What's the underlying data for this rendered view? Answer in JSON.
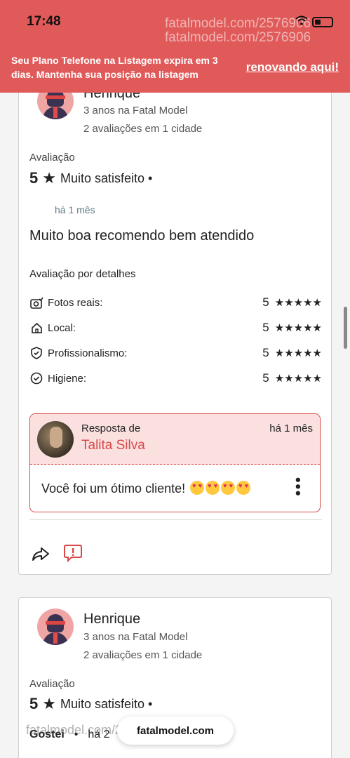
{
  "status": {
    "time": "17:48"
  },
  "watermark": {
    "top_line1": "fatalmodel.com/2576906",
    "top_line2": "fatalmodel.com/2576906",
    "bottom": "fatalmodel.com/2576906"
  },
  "banner": {
    "message": "Seu Plano Telefone na Listagem expira em 3 dias. Mantenha sua posição na listagem",
    "link": "renovando aqui!",
    "color": "#e15a5a"
  },
  "review1": {
    "user_name": "Henrique",
    "user_since": "3 anos na Fatal Model",
    "user_reviews": "2 avaliações em 1 cidade",
    "rating_label": "Avaliação",
    "score": "5",
    "star": "★",
    "verdict": "Muito satisfeito •",
    "time_ago": "há 1 mês",
    "comment": "Muito boa recomendo bem atendido",
    "details_label": "Avaliação por detalhes",
    "details": [
      {
        "label": "Fotos reais:",
        "score": "5",
        "stars": "★★★★★",
        "icon": "camera-check-icon"
      },
      {
        "label": "Local:",
        "score": "5",
        "stars": "★★★★★",
        "icon": "home-icon"
      },
      {
        "label": "Profissionalismo:",
        "score": "5",
        "stars": "★★★★★",
        "icon": "shield-check-icon"
      },
      {
        "label": "Higiene:",
        "score": "5",
        "stars": "★★★★★",
        "icon": "check-circle-icon"
      }
    ],
    "response": {
      "label": "Resposta de",
      "name": "Talita Silva",
      "time": "há 1 mês",
      "text": "Você foi um ótimo cliente!",
      "emoji_count": 4
    }
  },
  "review2": {
    "user_name": "Henrique",
    "user_since": "3 anos na Fatal Model",
    "user_reviews": "2 avaliações em 1 cidade",
    "rating_label": "Avaliação",
    "score": "5",
    "star": "★",
    "verdict": "Muito satisfeito •",
    "peek_name": "Gostei",
    "peek_dot": "•",
    "peek_time": "há 2"
  },
  "url_bar": {
    "url": "fatalmodel.com"
  },
  "colors": {
    "accent": "#d94848",
    "response_bg": "#fbe0e0",
    "time_ago": "#5f7d86"
  }
}
